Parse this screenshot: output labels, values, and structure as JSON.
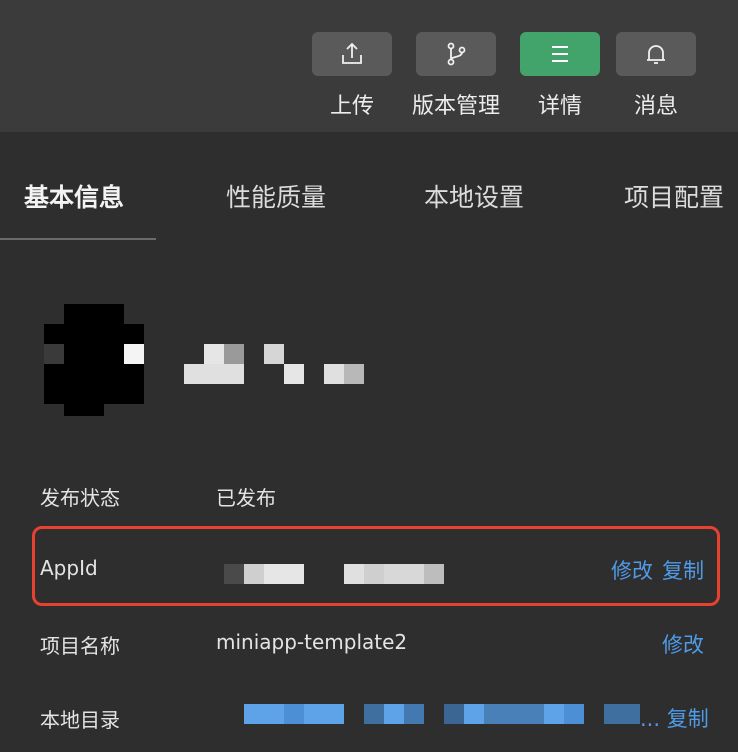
{
  "toolbar": {
    "upload": {
      "label": "上传",
      "icon": "upload-icon"
    },
    "version": {
      "label": "版本管理",
      "icon": "branch-icon"
    },
    "details": {
      "label": "详情",
      "icon": "menu-icon"
    },
    "messages": {
      "label": "消息",
      "icon": "bell-icon"
    }
  },
  "colors": {
    "accent_green": "#42a46a",
    "link_blue": "#4f9be8",
    "highlight_red": "#e8412f"
  },
  "tabs": [
    {
      "label": "基本信息",
      "active": true
    },
    {
      "label": "性能质量",
      "active": false
    },
    {
      "label": "本地设置",
      "active": false
    },
    {
      "label": "项目配置",
      "active": false
    }
  ],
  "info": {
    "publish_status": {
      "label": "发布状态",
      "value": "已发布"
    },
    "appid": {
      "label": "AppId",
      "edit": "修改",
      "copy": "复制"
    },
    "project_name": {
      "label": "项目名称",
      "value": "miniapp-template2",
      "edit": "修改"
    },
    "local_dir": {
      "label": "本地目录",
      "copy": "... 复制"
    }
  }
}
